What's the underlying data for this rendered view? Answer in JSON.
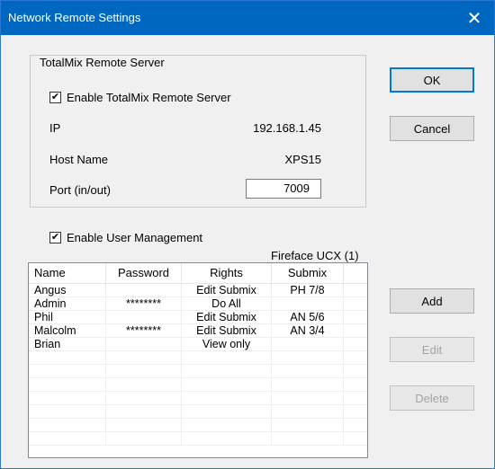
{
  "window": {
    "title": "Network Remote Settings"
  },
  "server_group": {
    "title": "TotalMix Remote Server",
    "enable_label": "Enable TotalMix Remote Server",
    "enable_checked": true,
    "ip_label": "IP",
    "ip_value": "192.168.1.45",
    "host_label": "Host Name",
    "host_value": "XPS15",
    "port_label": "Port (in/out)",
    "port_value": "7009"
  },
  "user_mgmt": {
    "enable_label": "Enable User Management",
    "enable_checked": true,
    "device_label": "Fireface UCX (1)"
  },
  "table": {
    "columns": [
      "Name",
      "Password",
      "Rights",
      "Submix"
    ],
    "rows": [
      [
        "Angus",
        "",
        "Edit Submix",
        "PH 7/8"
      ],
      [
        "Admin",
        "********",
        "Do All",
        ""
      ],
      [
        "Phil",
        "",
        "Edit Submix",
        "AN 5/6"
      ],
      [
        "Malcolm",
        "********",
        "Edit Submix",
        "AN 3/4"
      ],
      [
        "Brian",
        "",
        "View only",
        ""
      ],
      [
        "",
        "",
        "",
        ""
      ],
      [
        "",
        "",
        "",
        ""
      ],
      [
        "",
        "",
        "",
        ""
      ],
      [
        "",
        "",
        "",
        ""
      ],
      [
        "",
        "",
        "",
        ""
      ],
      [
        "",
        "",
        "",
        ""
      ],
      [
        "",
        "",
        "",
        ""
      ]
    ]
  },
  "buttons": {
    "ok": "OK",
    "cancel": "Cancel",
    "add": "Add",
    "edit": "Edit",
    "delete": "Delete"
  },
  "icons": {
    "close": "close-icon",
    "check": "check-icon"
  }
}
